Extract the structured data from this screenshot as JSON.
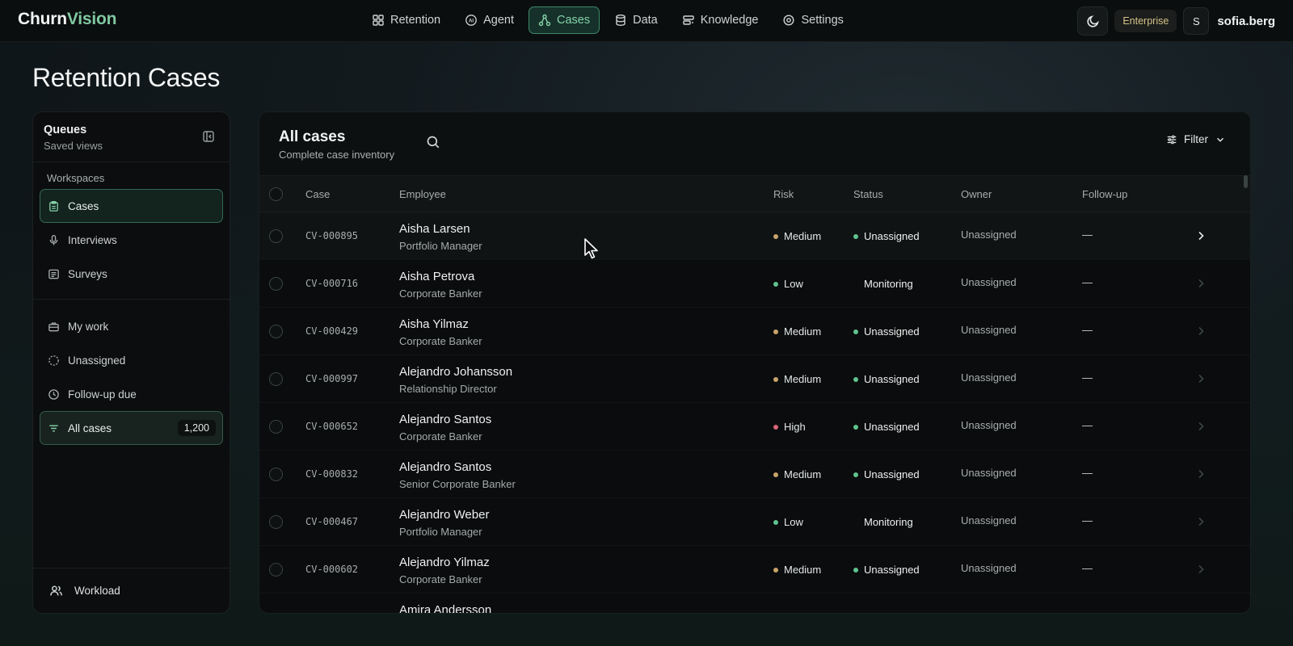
{
  "app": {
    "logo_part1": "Churn",
    "logo_part2": "Vision"
  },
  "nav": [
    {
      "label": "Retention",
      "icon": "grid-icon"
    },
    {
      "label": "Agent",
      "icon": "ai-icon"
    },
    {
      "label": "Cases",
      "icon": "cases-network-icon",
      "active": true
    },
    {
      "label": "Data",
      "icon": "database-icon"
    },
    {
      "label": "Knowledge",
      "icon": "knowledge-icon"
    },
    {
      "label": "Settings",
      "icon": "gear-icon"
    }
  ],
  "user": {
    "plan": "Enterprise",
    "initial": "S",
    "name": "sofia.berg"
  },
  "page": {
    "title": "Retention Cases"
  },
  "sidebar": {
    "title": "Queues",
    "subtitle": "Saved views",
    "section": "Workspaces",
    "workspaces": [
      {
        "label": "Cases",
        "icon": "clipboard-icon"
      },
      {
        "label": "Interviews",
        "icon": "mic-icon"
      },
      {
        "label": "Surveys",
        "icon": "survey-icon"
      }
    ],
    "views": [
      {
        "label": "My work",
        "icon": "briefcase-icon"
      },
      {
        "label": "Unassigned",
        "icon": "dashed-circle-icon"
      },
      {
        "label": "Follow-up due",
        "icon": "clock-icon"
      },
      {
        "label": "All cases",
        "icon": "filter-lines-icon",
        "count": "1,200"
      }
    ],
    "footer": "Workload"
  },
  "panel": {
    "title": "All cases",
    "subtitle": "Complete case inventory",
    "filter_label": "Filter",
    "columns": [
      "Case",
      "Employee",
      "Risk",
      "Status",
      "Owner",
      "Follow-up"
    ],
    "rows": [
      {
        "case": "CV-000895",
        "name": "Aisha Larsen",
        "role": "Portfolio Manager",
        "risk": "Medium",
        "status": "Unassigned",
        "owner": "Unassigned",
        "follow": "—"
      },
      {
        "case": "CV-000716",
        "name": "Aisha Petrova",
        "role": "Corporate Banker",
        "risk": "Low",
        "status": "Monitoring",
        "owner": "Unassigned",
        "follow": "—"
      },
      {
        "case": "CV-000429",
        "name": "Aisha Yilmaz",
        "role": "Corporate Banker",
        "risk": "Medium",
        "status": "Unassigned",
        "owner": "Unassigned",
        "follow": "—"
      },
      {
        "case": "CV-000997",
        "name": "Alejandro Johansson",
        "role": "Relationship Director",
        "risk": "Medium",
        "status": "Unassigned",
        "owner": "Unassigned",
        "follow": "—"
      },
      {
        "case": "CV-000652",
        "name": "Alejandro Santos",
        "role": "Corporate Banker",
        "risk": "High",
        "status": "Unassigned",
        "owner": "Unassigned",
        "follow": "—"
      },
      {
        "case": "CV-000832",
        "name": "Alejandro Santos",
        "role": "Senior Corporate Banker",
        "risk": "Medium",
        "status": "Unassigned",
        "owner": "Unassigned",
        "follow": "—"
      },
      {
        "case": "CV-000467",
        "name": "Alejandro Weber",
        "role": "Portfolio Manager",
        "risk": "Low",
        "status": "Monitoring",
        "owner": "Unassigned",
        "follow": "—"
      },
      {
        "case": "CV-000602",
        "name": "Alejandro Yilmaz",
        "role": "Corporate Banker",
        "risk": "Medium",
        "status": "Unassigned",
        "owner": "Unassigned",
        "follow": "—"
      },
      {
        "case": "",
        "name": "Amira Andersson",
        "role": "",
        "risk": "",
        "status": "",
        "owner": "",
        "follow": ""
      }
    ]
  },
  "colors": {
    "accent": "#7fc8a0",
    "risk_medium": "#c9a36a",
    "risk_low": "#5fc48e",
    "risk_high": "#d9647a",
    "status_unassigned": "#5fc48e"
  }
}
